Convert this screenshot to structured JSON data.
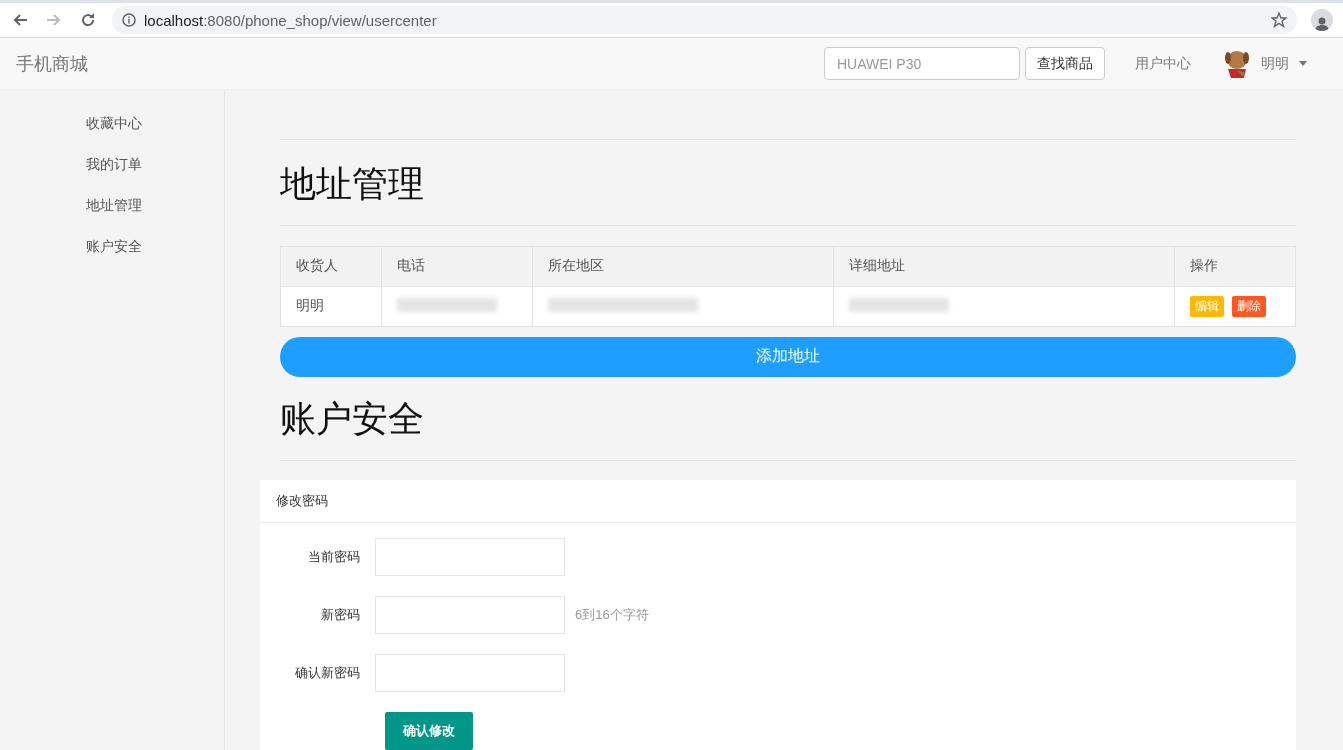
{
  "browser": {
    "url_host": "localhost",
    "url_rest": ":8080/phone_shop/view/usercenter"
  },
  "navbar": {
    "brand": "手机商城",
    "search": {
      "placeholder": "HUAWEI P30"
    },
    "search_button": "查找商品",
    "links": [
      "用户中心"
    ],
    "user": "明明"
  },
  "sidebar": {
    "items": [
      "收藏中心",
      "我的订单",
      "地址管理",
      "账户安全"
    ]
  },
  "address_section": {
    "title": "地址管理",
    "table": {
      "columns": [
        "收货人",
        "电话",
        "所在地区",
        "详细地址",
        "操作"
      ],
      "rows": [
        {
          "name": "明明",
          "actions": [
            {
              "label": "编辑",
              "kind": "edit"
            },
            {
              "label": "删除",
              "kind": "delete"
            }
          ]
        }
      ]
    },
    "add_button": "添加地址"
  },
  "security_section": {
    "title": "账户安全",
    "panel_title": "修改密码",
    "fields": [
      {
        "label": "当前密码"
      },
      {
        "label": "新密码",
        "hint": "6到16个字符"
      },
      {
        "label": "确认新密码"
      }
    ],
    "submit": "确认修改"
  }
}
